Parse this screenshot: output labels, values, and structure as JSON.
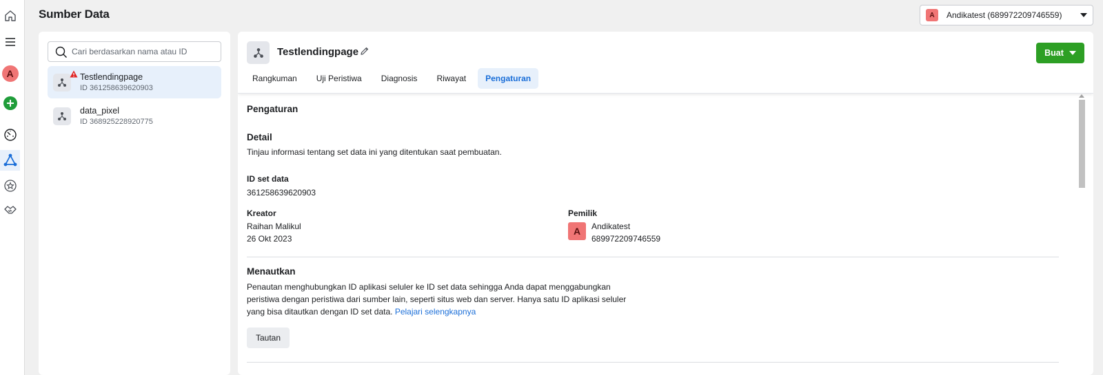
{
  "header": {
    "title": "Sumber Data",
    "account": {
      "badge": "A",
      "label": "Andikatest (689972209746559)"
    }
  },
  "rail": {
    "avatar": "A"
  },
  "list": {
    "search_placeholder": "Cari berdasarkan nama atau ID",
    "items": [
      {
        "name": "Testlendingpage",
        "id": "ID 361258639620903",
        "selected": true,
        "warning": true
      },
      {
        "name": "data_pixel",
        "id": "ID 368925228920775",
        "selected": false,
        "warning": false
      }
    ]
  },
  "detail": {
    "title": "Testlendingpage",
    "create_button": "Buat",
    "tabs": [
      {
        "label": "Rangkuman",
        "active": false
      },
      {
        "label": "Uji Peristiwa",
        "active": false
      },
      {
        "label": "Diagnosis",
        "active": false
      },
      {
        "label": "Riwayat",
        "active": false
      },
      {
        "label": "Pengaturan",
        "active": true
      }
    ],
    "settings": {
      "heading": "Pengaturan",
      "detail_heading": "Detail",
      "detail_desc": "Tinjau informasi tentang set data ini yang ditentukan saat pembuatan.",
      "dataset_id_label": "ID set data",
      "dataset_id": "361258639620903",
      "creator_label": "Kreator",
      "creator_name": "Raihan Malikul",
      "creator_date": "26 Okt 2023",
      "owner_label": "Pemilik",
      "owner_badge": "A",
      "owner_name": "Andikatest",
      "owner_id": "689972209746559",
      "link_heading": "Menautkan",
      "link_desc_1": "Penautan menghubungkan ID aplikasi seluler ke ID set data sehingga Anda dapat menggabungkan",
      "link_desc_2": "peristiwa dengan peristiwa dari sumber lain, seperti situs web dan server. Hanya satu ID aplikasi seluler",
      "link_desc_3": "yang bisa ditautkan dengan ID set data.",
      "learn_more": "Pelajari selengkapnya",
      "link_button": "Tautan"
    }
  },
  "colors": {
    "accent": "#1a6ed8",
    "create": "#2d9f24",
    "avatar": "#f07575",
    "warning": "#e02424"
  }
}
